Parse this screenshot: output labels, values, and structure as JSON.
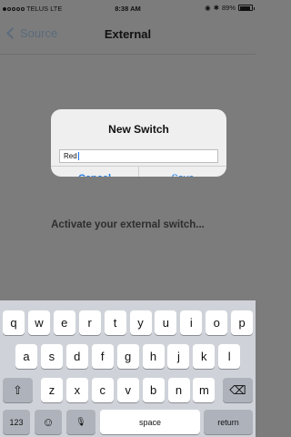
{
  "status": {
    "carrier": "TELUS",
    "network": "LTE",
    "time": "8:38 AM",
    "battery_pct": "89%",
    "battery_level": 0.89
  },
  "nav": {
    "back_label": "Source",
    "title": "External"
  },
  "background_text": "Activate your external switch...",
  "dialog": {
    "title": "New Switch",
    "input_value": "Red",
    "cancel_label": "Cancel",
    "save_label": "Save"
  },
  "keyboard": {
    "row1": [
      "q",
      "w",
      "e",
      "r",
      "t",
      "y",
      "u",
      "i",
      "o",
      "p"
    ],
    "row2": [
      "a",
      "s",
      "d",
      "f",
      "g",
      "h",
      "j",
      "k",
      "l"
    ],
    "row3": [
      "z",
      "x",
      "c",
      "v",
      "b",
      "n",
      "m"
    ],
    "numbers_label": "123",
    "space_label": "space",
    "return_label": "return",
    "shift_symbol": "⇧",
    "delete_symbol": "⌫",
    "emoji_symbol": "☺",
    "mic_symbol": "🎙"
  }
}
